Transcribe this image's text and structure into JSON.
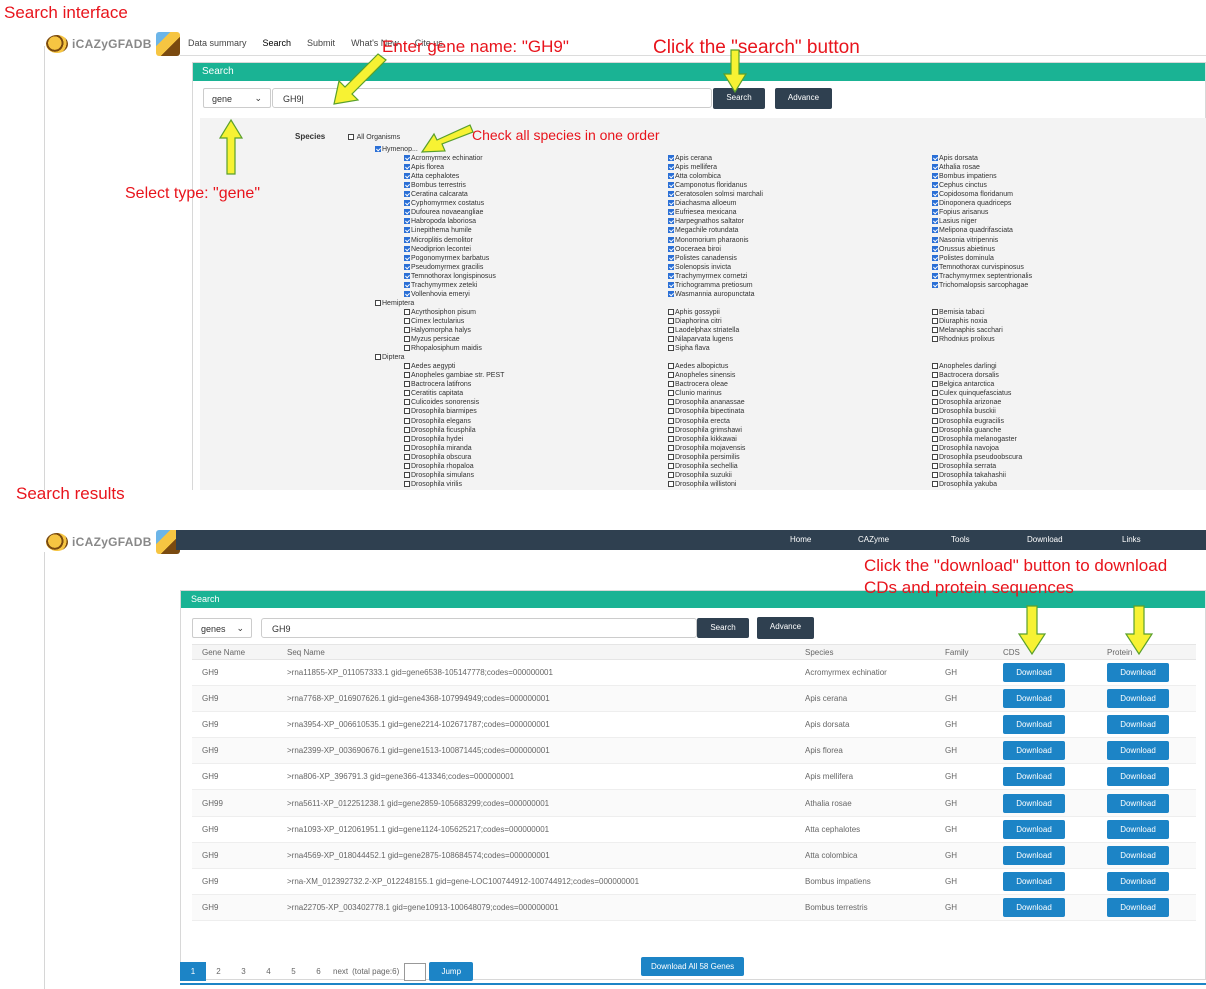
{
  "section_labels": {
    "top": "Search interface",
    "bottom": "Search results"
  },
  "annotations": {
    "enter_gene": "Enter gene name: \"GH9\"",
    "click_search": "Click the \"search\" button",
    "check_species": "Check  all species in one order",
    "select_type": "Select type: \"gene\"",
    "click_download_1": "Click the \"download\" button to download",
    "click_download_2": "CDs and protein sequences"
  },
  "brand": {
    "logo_text": "iCAZyGFADB"
  },
  "top_nav": {
    "tabs": [
      "Data summary",
      "Search",
      "Submit",
      "What's New",
      "Cite us"
    ],
    "active_tab": "Search"
  },
  "search_form": {
    "card_title": "Search",
    "type_select_value": "gene",
    "query_value": "GH9|",
    "search_label": "Search",
    "advance_label": "Advance",
    "species_label": "Species",
    "all_organisms_label": "All Organisms"
  },
  "species_tree": [
    {
      "order": "Hymenoptera",
      "label": "Hymenop...",
      "checked": true,
      "cols": [
        [
          "Acromyrmex echinatior",
          "Apis florea",
          "Atta cephalotes",
          "Bombus terrestris",
          "Ceratina calcarata",
          "Cyphomyrmex costatus",
          "Dufourea novaeangliae",
          "Habropoda laboriosa",
          "Linepithema humile",
          "Microplitis demolitor",
          "Neodiprion lecontei",
          "Pogonomyrmex barbatus",
          "Pseudomyrmex gracilis",
          "Temnothorax longispinosus",
          "Trachymyrmex zeteki",
          "Vollenhovia emeryi"
        ],
        [
          "Apis cerana",
          "Apis mellifera",
          "Atta colombica",
          "Camponotus floridanus",
          "Ceratosolen solmsi marchali",
          "Diachasma alloeum",
          "Eufriesea mexicana",
          "Harpegnathos saltator",
          "Megachile rotundata",
          "Monomorium pharaonis",
          "Ooceraea biroi",
          "Polistes canadensis",
          "Solenopsis invicta",
          "Trachymyrmex cornetzi",
          "Trichogramma pretiosum",
          "Wasmannia auropunctata"
        ],
        [
          "Apis dorsata",
          "Athalia rosae",
          "Bombus impatiens",
          "Cephus cinctus",
          "Copidosoma floridanum",
          "Dinoponera quadriceps",
          "Fopius arisanus",
          "Lasius niger",
          "Melipona quadrifasciata",
          "Nasonia vitripennis",
          "Orussus abietinus",
          "Polistes dominula",
          "Temnothorax curvispinosus",
          "Trachymyrmex septentrionalis",
          "Trichomalopsis sarcophagae"
        ]
      ]
    },
    {
      "order": "Hemiptera",
      "label": "Hemiptera",
      "checked": false,
      "cols": [
        [
          "Acyrthosiphon pisum",
          "Cimex lectularius",
          "Halyomorpha halys",
          "Myzus persicae",
          "Rhopalosiphum maidis"
        ],
        [
          "Aphis gossypii",
          "Diaphorina citri",
          "Laodelphax striatella",
          "Nilaparvata lugens",
          "Sipha flava"
        ],
        [
          "Bemisia tabaci",
          "Diuraphis noxia",
          "Melanaphis sacchari",
          "Rhodnius prolixus"
        ]
      ]
    },
    {
      "order": "Diptera",
      "label": "Diptera",
      "checked": false,
      "cols": [
        [
          "Aedes aegypti",
          "Anopheles gambiae str. PEST",
          "Bactrocera latifrons",
          "Ceratitis capitata",
          "Culicoides sonorensis",
          "Drosophila biarmipes",
          "Drosophila elegans",
          "Drosophila ficusphila",
          "Drosophila hydei",
          "Drosophila miranda",
          "Drosophila obscura",
          "Drosophila rhopaloa",
          "Drosophila simulans",
          "Drosophila virilis"
        ],
        [
          "Aedes albopictus",
          "Anopheles sinensis",
          "Bactrocera oleae",
          "Clunio marinus",
          "Drosophila ananassae",
          "Drosophila bipectinata",
          "Drosophila erecta",
          "Drosophila grimshawi",
          "Drosophila kikkawai",
          "Drosophila mojavensis",
          "Drosophila persimilis",
          "Drosophila sechellia",
          "Drosophila suzukii",
          "Drosophila willistoni"
        ],
        [
          "Anopheles darlingi",
          "Bactrocera dorsalis",
          "Belgica antarctica",
          "Culex quinquefasciatus",
          "Drosophila arizonae",
          "Drosophila busckii",
          "Drosophila eugracilis",
          "Drosophila guanche",
          "Drosophila melanogaster",
          "Drosophila navojoa",
          "Drosophila pseudoobscura",
          "Drosophila serrata",
          "Drosophila takahashii",
          "Drosophila yakuba"
        ]
      ]
    }
  ],
  "results_nav": [
    "Home",
    "CAZyme",
    "Tools",
    "Download",
    "Links"
  ],
  "results_form": {
    "card_title": "Search",
    "type_select_value": "genes",
    "query_value": "GH9",
    "search_label": "Search",
    "advance_label": "Advance"
  },
  "results_table": {
    "headers": [
      "Gene Name",
      "Seq Name",
      "Species",
      "Family",
      "CDS",
      "Protein"
    ],
    "download_label": "Download",
    "rows": [
      [
        "GH9",
        ">rna11855-XP_011057333.1 gid=gene6538-105147778;codes=000000001",
        "Acromyrmex echinatior",
        "GH"
      ],
      [
        "GH9",
        ">rna7768-XP_016907626.1 gid=gene4368-107994949;codes=000000001",
        "Apis cerana",
        "GH"
      ],
      [
        "GH9",
        ">rna3954-XP_006610535.1 gid=gene2214-102671787;codes=000000001",
        "Apis dorsata",
        "GH"
      ],
      [
        "GH9",
        ">rna2399-XP_003690676.1 gid=gene1513-100871445;codes=000000001",
        "Apis florea",
        "GH"
      ],
      [
        "GH9",
        ">rna806-XP_396791.3 gid=gene366-413346;codes=000000001",
        "Apis mellifera",
        "GH"
      ],
      [
        "GH99",
        ">rna5611-XP_012251238.1 gid=gene2859-105683299;codes=000000001",
        "Athalia rosae",
        "GH"
      ],
      [
        "GH9",
        ">rna1093-XP_012061951.1 gid=gene1124-105625217;codes=000000001",
        "Atta cephalotes",
        "GH"
      ],
      [
        "GH9",
        ">rna4569-XP_018044452.1 gid=gene2875-108684574;codes=000000001",
        "Atta colombica",
        "GH"
      ],
      [
        "GH9",
        ">rna-XM_012392732.2-XP_012248155.1 gid=gene-LOC100744912-100744912;codes=000000001",
        "Bombus impatiens",
        "GH"
      ],
      [
        "GH9",
        ">rna22705-XP_003402778.1 gid=gene10913-100648079;codes=000000001",
        "Bombus terrestris",
        "GH"
      ]
    ],
    "download_all_label": "Download All 58 Genes"
  },
  "pagination": {
    "pages": [
      "1",
      "2",
      "3",
      "4",
      "5",
      "6"
    ],
    "current": "1",
    "next_label": "next",
    "total_label": "(total page:6)",
    "jump_label": "Jump"
  },
  "colors": {
    "annotation_red": "#e8141c",
    "header_teal": "#1ab394",
    "nav_dark": "#2f4050",
    "button_blue": "#1c84c6",
    "arrow_fill": "#f7f233",
    "arrow_stroke": "#5aa02c"
  }
}
